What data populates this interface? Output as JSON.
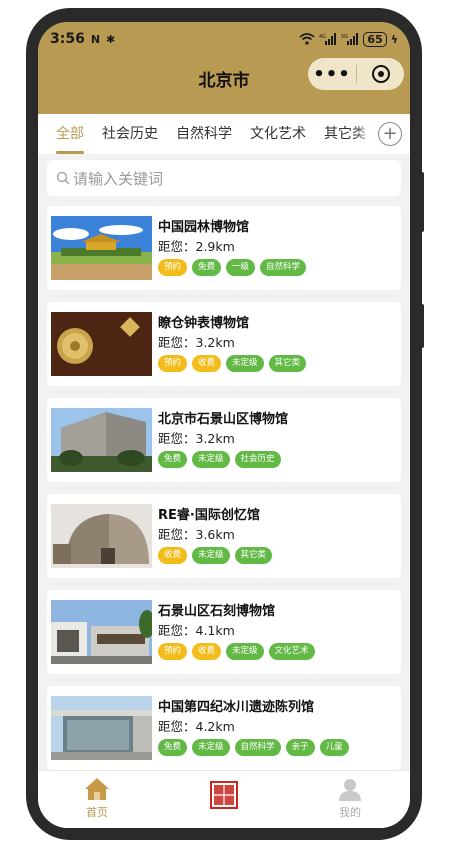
{
  "status_bar": {
    "time": "3:56",
    "battery": "65"
  },
  "header": {
    "title": "北京市",
    "more_icon": "more-dots-icon",
    "close_icon": "capsule-close-icon",
    "accent": "#b99a52"
  },
  "tabs": {
    "items": [
      "全部",
      "社会历史",
      "自然科学",
      "文化艺术",
      "其它类"
    ],
    "active_index": 0
  },
  "search": {
    "placeholder": "请输入关键词"
  },
  "museums": [
    {
      "name": "中国园林博物馆",
      "distance": "距您：2.9km",
      "tags": [
        {
          "text": "预约",
          "color": "#f2bd1b"
        },
        {
          "text": "免费",
          "color": "#62b945"
        },
        {
          "text": "一级",
          "color": "#62b945"
        },
        {
          "text": "自然科学",
          "color": "#62b945"
        }
      ]
    },
    {
      "name": "瞭仓钟表博物馆",
      "distance": "距您：3.2km",
      "tags": [
        {
          "text": "预约",
          "color": "#f2bd1b"
        },
        {
          "text": "收费",
          "color": "#f2bd1b"
        },
        {
          "text": "未定级",
          "color": "#62b945"
        },
        {
          "text": "其它类",
          "color": "#62b945"
        }
      ]
    },
    {
      "name": "北京市石景山区博物馆",
      "distance": "距您：3.2km",
      "tags": [
        {
          "text": "免费",
          "color": "#62b945"
        },
        {
          "text": "未定级",
          "color": "#62b945"
        },
        {
          "text": "社会历史",
          "color": "#62b945"
        }
      ]
    },
    {
      "name": "RE睿·国际创忆馆",
      "distance": "距您：3.6km",
      "tags": [
        {
          "text": "收费",
          "color": "#f2bd1b"
        },
        {
          "text": "未定级",
          "color": "#62b945"
        },
        {
          "text": "其它类",
          "color": "#62b945"
        }
      ]
    },
    {
      "name": "石景山区石刻博物馆",
      "distance": "距您：4.1km",
      "tags": [
        {
          "text": "预约",
          "color": "#f2bd1b"
        },
        {
          "text": "收费",
          "color": "#f2bd1b"
        },
        {
          "text": "未定级",
          "color": "#62b945"
        },
        {
          "text": "文化艺术",
          "color": "#62b945"
        }
      ]
    },
    {
      "name": "中国第四纪冰川遗迹陈列馆",
      "distance": "距您：4.2km",
      "tags": [
        {
          "text": "免费",
          "color": "#62b945"
        },
        {
          "text": "未定级",
          "color": "#62b945"
        },
        {
          "text": "自然科学",
          "color": "#62b945"
        },
        {
          "text": "亲子",
          "color": "#62b945"
        },
        {
          "text": "儿童",
          "color": "#62b945"
        }
      ]
    }
  ],
  "bottom_nav": {
    "home": "首页",
    "mine": "我的",
    "center_logo": "文博畅游"
  }
}
